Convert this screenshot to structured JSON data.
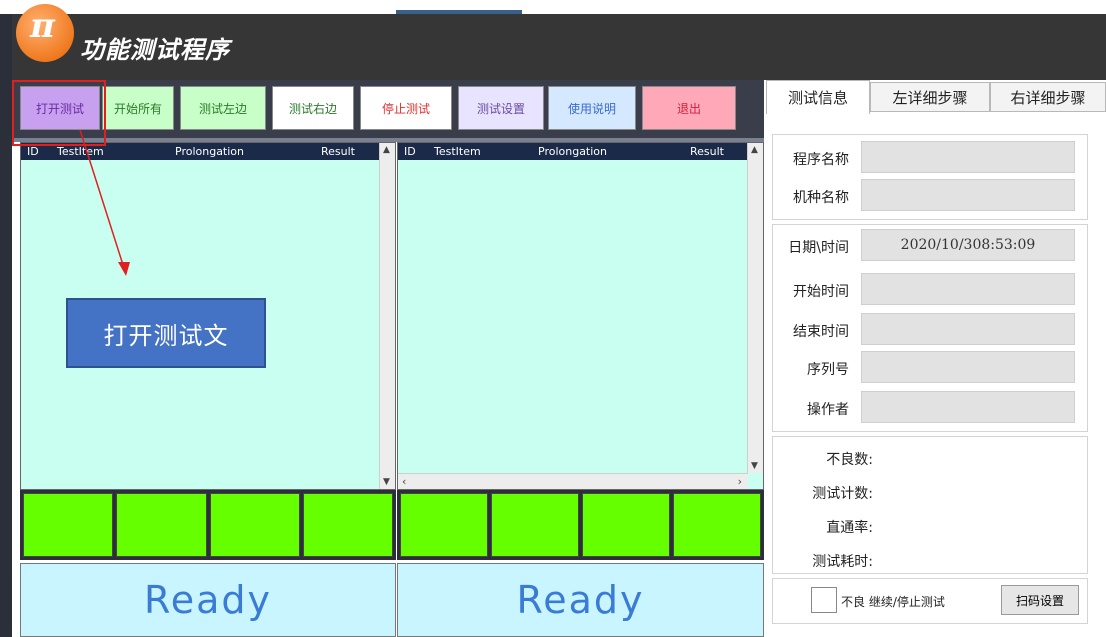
{
  "app": {
    "title": "功能测试程序",
    "logo_glyph": "π"
  },
  "toolbar": {
    "buttons": [
      {
        "label": "打开测试",
        "bg": "#c8a0f0",
        "color": "#6a2aa0"
      },
      {
        "label": "开始所有",
        "bg": "#c8ffc8",
        "color": "#2a7a2a"
      },
      {
        "label": "测试左边",
        "bg": "#c8ffc8",
        "color": "#2a7a2a"
      },
      {
        "label": "测试右边",
        "bg": "#ffffff",
        "color": "#2a7a2a"
      },
      {
        "label": "停止测试",
        "bg": "#ffffff",
        "color": "#e03030"
      },
      {
        "label": "测试设置",
        "bg": "#e8e4ff",
        "color": "#6a4aa0"
      },
      {
        "label": "使用说明",
        "bg": "#d4e8ff",
        "color": "#3a6ad0"
      },
      {
        "label": "退出",
        "bg": "#ffa8b8",
        "color": "#d02040"
      }
    ]
  },
  "grid_left": {
    "columns": [
      "ID",
      "TestItem",
      "Prolongation",
      "Result"
    ]
  },
  "grid_right": {
    "columns": [
      "ID",
      "TestItem",
      "Prolongation",
      "Result"
    ]
  },
  "status": {
    "left": "Ready",
    "right": "Ready"
  },
  "overlay": {
    "text": "打开测试文"
  },
  "tabs": [
    "测试信息",
    "左详细步骤",
    "右详细步骤"
  ],
  "info": {
    "program_name_label": "程序名称",
    "model_name_label": "机种名称",
    "datetime_label": "日期\\时间",
    "datetime_value": "2020/10/308:53:09",
    "start_time_label": "开始时间",
    "end_time_label": "结束时间",
    "serial_label": "序列号",
    "operator_label": "操作者"
  },
  "stats": {
    "defects_label": "不良数:",
    "count_label": "测试计数:",
    "yield_label": "直通率:",
    "elapsed_label": "测试耗时:"
  },
  "bottom": {
    "checkbox_label": "不良 继续/停止测试",
    "scan_button": "扫码设置"
  }
}
